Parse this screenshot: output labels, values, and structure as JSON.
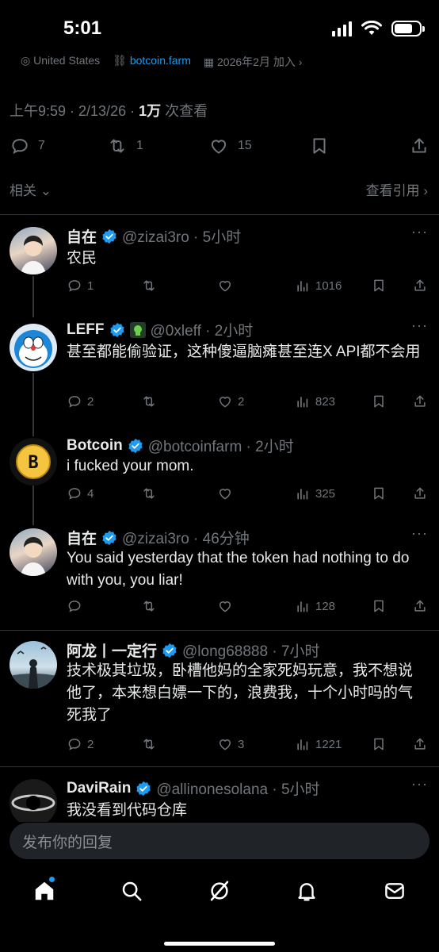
{
  "status": {
    "time": "5:01"
  },
  "profile_meta": {
    "location": "United States",
    "link": "botcoin.farm",
    "joined": "2026年2月 加入"
  },
  "tweet": {
    "timestamp": "上午9:59 · 2/13/26 · ",
    "views_count": "1万",
    "views_label": " 次查看",
    "replies": "7",
    "retweets": "1",
    "likes": "15"
  },
  "related": {
    "label": "相关",
    "quotes_label": "查看引用"
  },
  "replies": [
    {
      "name": "自在",
      "handle": "@zizai3ro · 5小时",
      "text": "农民",
      "comments": "1",
      "retweets": "",
      "likes": "",
      "views": "1016"
    },
    {
      "name": "LEFF",
      "handle": "@0xleff · 2小时",
      "text": "甚至都能偷验证，这种傻逼脑瘫甚至连X API都不会用",
      "comments": "2",
      "retweets": "",
      "likes": "2",
      "views": "823"
    },
    {
      "name": "Botcoin",
      "handle": "@botcoinfarm · 2小时",
      "text": "i fucked your mom.",
      "comments": "4",
      "retweets": "",
      "likes": "",
      "views": "325"
    },
    {
      "name": "自在",
      "handle": "@zizai3ro · 46分钟",
      "text": "You said yesterday that the token had nothing to do with you, you liar!",
      "comments": "",
      "retweets": "",
      "likes": "",
      "views": "128"
    },
    {
      "name": "阿龙丨一定行",
      "handle": "@long68888 · 7小时",
      "text": "技术极其垃圾，卧槽他妈的全家死妈玩意，我不想说他了，本来想白嫖一下的，浪费我，十个小时吗的气死我了",
      "comments": "2",
      "retweets": "",
      "likes": "3",
      "views": "1221"
    },
    {
      "name": "DaviRain",
      "handle": "@allinonesolana · 5小时",
      "text": "我没看到代码仓库",
      "comments": "",
      "retweets": "",
      "likes": "",
      "views": ""
    }
  ],
  "composer": {
    "placeholder": "发布你的回复"
  },
  "more_label": "···",
  "colors": {
    "accent": "#1d9bf0",
    "muted": "#71767b",
    "bg": "#000000"
  }
}
